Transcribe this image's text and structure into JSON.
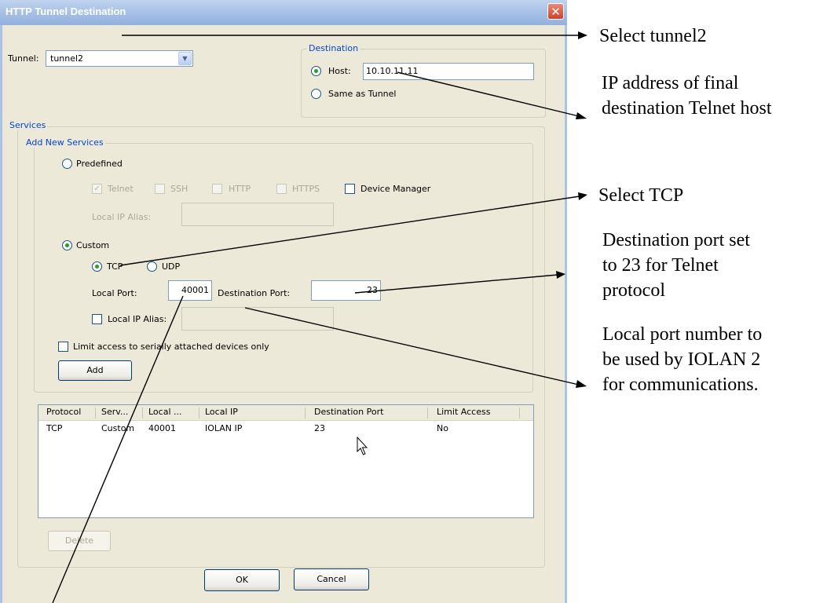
{
  "window": {
    "title": "HTTP Tunnel Destination"
  },
  "tunnel": {
    "label": "Tunnel:",
    "value": "tunnel2"
  },
  "destination": {
    "legend": "Destination",
    "host_label": "Host:",
    "host_value": "10.10.11.11",
    "same_as_tunnel_label": "Same as Tunnel"
  },
  "services": {
    "legend": "Services",
    "add_new_legend": "Add New Services",
    "predefined_label": "Predefined",
    "predefined_options": {
      "telnet": "Telnet",
      "ssh": "SSH",
      "http": "HTTP",
      "https": "HTTPS",
      "device_manager": "Device Manager"
    },
    "predefined_local_ip_alias_label": "Local IP Alias:",
    "custom_label": "Custom",
    "tcp_label": "TCP",
    "udp_label": "UDP",
    "local_port_label": "Local Port:",
    "local_port_value": "40001",
    "destination_port_label": "Destination Port:",
    "destination_port_value": "23",
    "local_ip_alias_label": "Local IP Alias:",
    "limit_access_label": "Limit access to serially attached devices only",
    "add_button": "Add"
  },
  "table": {
    "columns": [
      "Protocol",
      "Serv...",
      "Local ...",
      "Local IP",
      "Destination Port",
      "Limit Access"
    ],
    "rows": [
      [
        "TCP",
        "Custom",
        "40001",
        "IOLAN IP",
        "23",
        "No"
      ]
    ]
  },
  "buttons": {
    "delete": "Delete",
    "ok": "OK",
    "cancel": "Cancel"
  },
  "annotations": {
    "select_tunnel": "Select tunnel2",
    "ip_address_line1": "IP address of final",
    "ip_address_line2": "destination Telnet host",
    "select_tcp": "Select TCP",
    "dest_port_line1": "Destination port set",
    "dest_port_line2": "to 23 for Telnet",
    "dest_port_line3": "protocol",
    "local_port_line1": "Local port number to",
    "local_port_line2": "be used by IOLAN 2",
    "local_port_line3": "for communications."
  },
  "colors": {
    "title_bar": "#a9c2e6",
    "dialog_bg": "#ece9d8",
    "group_legend": "#0046d5",
    "radio_dot": "#21a121",
    "close_button": "#c9452d"
  },
  "icons": {
    "close": "close-icon",
    "dropdown": "chevron-down-icon",
    "cursor": "mouse-pointer-icon"
  }
}
